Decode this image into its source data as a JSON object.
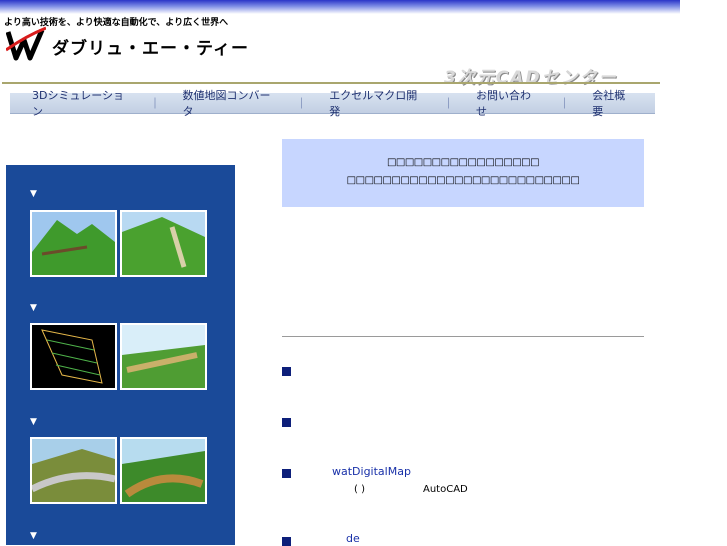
{
  "header": {
    "tagline": "より高い技術を、より快適な自動化で、より広く世界へ",
    "company_name": "ダブリュ・エー・ティー",
    "center_title": "3次元CADセンター"
  },
  "nav": {
    "items": [
      {
        "label": "3Dシミュレーション"
      },
      {
        "label": "数値地図コンバータ"
      },
      {
        "label": "エクセルマクロ開発"
      },
      {
        "label": "お問い合わせ"
      },
      {
        "label": "会社概要"
      }
    ],
    "separator": "｜"
  },
  "sidebar": {
    "arrow": "▼"
  },
  "info_box": {
    "line1": "□□□□□□□□□□□□□□□□□",
    "line2": "□□□□□□□□□□□□□□□□□□□□□□□□□□"
  },
  "list": {
    "item2_link": "watDigitalMap",
    "item2_paren": "(   )",
    "item2_suffix": "AutoCAD",
    "item3_link": "de"
  },
  "colors": {
    "sidebar_bg": "#1a4a99",
    "info_box_bg": "#c7d6ff",
    "bullet": "#0d1f7a",
    "link": "#1830a8"
  }
}
